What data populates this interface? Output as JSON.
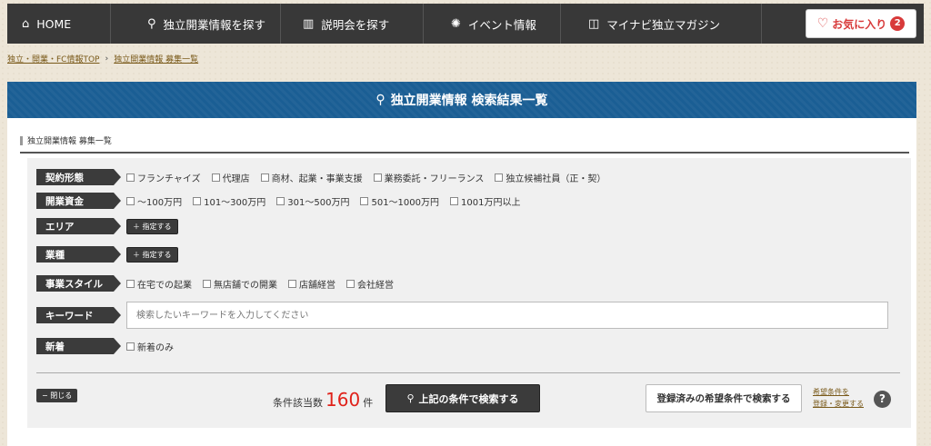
{
  "nav": {
    "items": [
      {
        "icon": "home-icon",
        "glyph": "⌂",
        "label": "HOME"
      },
      {
        "icon": "search-icon",
        "glyph": "⚲",
        "label": "独立開業情報を探す"
      },
      {
        "icon": "building-icon",
        "glyph": "▥",
        "label": "説明会を探す"
      },
      {
        "icon": "sparkle-icon",
        "glyph": "✺",
        "label": "イベント情報"
      },
      {
        "icon": "book-icon",
        "glyph": "◫",
        "label": "マイナビ独立マガジン"
      }
    ],
    "favorites_label": "お気に入り",
    "favorites_count": "2"
  },
  "breadcrumb": {
    "home": "独立・開業・FC情報TOP",
    "current": "独立開業情報 募集一覧"
  },
  "banner": {
    "title": "独立開業情報 検索結果一覧"
  },
  "subhead": "独立開業情報 募集一覧",
  "filters": {
    "contract": {
      "label": "契約形態",
      "options": [
        "フランチャイズ",
        "代理店",
        "商材、起業・事業支援",
        "業務委託・フリーランス",
        "独立候補社員（正・契）"
      ]
    },
    "funds": {
      "label": "開業資金",
      "options": [
        "〜100万円",
        "101〜300万円",
        "301〜500万円",
        "501〜1000万円",
        "1001万円以上"
      ]
    },
    "area": {
      "label": "エリア",
      "button": "＋ 指定する"
    },
    "industry": {
      "label": "業種",
      "button": "＋ 指定する"
    },
    "style": {
      "label": "事業スタイル",
      "options": [
        "在宅での起業",
        "無店舗での開業",
        "店舗経営",
        "会社経営"
      ]
    },
    "keyword": {
      "label": "キーワード",
      "placeholder": "検索したいキーワードを入力してください"
    },
    "newest": {
      "label": "新着",
      "options": [
        "新着のみ"
      ]
    }
  },
  "footer": {
    "close": "− 閉じる",
    "count_prefix": "条件該当数",
    "count": "160",
    "count_suffix": "件",
    "search_button": "上記の条件で検索する",
    "registered_button": "登録済みの希望条件で検索する",
    "reg_link_1": "希望条件を",
    "reg_link_2": "登録・変更する",
    "help": "?"
  }
}
